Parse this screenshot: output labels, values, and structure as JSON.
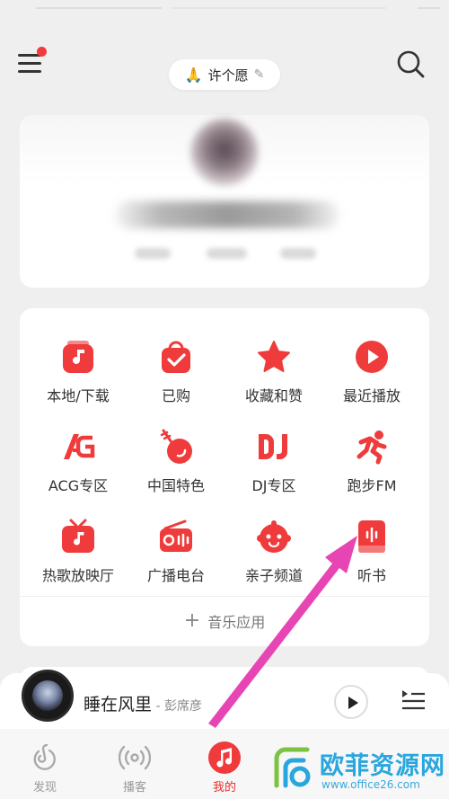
{
  "header": {
    "wish_label": "许个愿"
  },
  "grid": {
    "items": [
      {
        "label": "本地/下载",
        "icon": "music-note-file-icon"
      },
      {
        "label": "已购",
        "icon": "shopping-bag-check-icon"
      },
      {
        "label": "收藏和赞",
        "icon": "star-icon"
      },
      {
        "label": "最近播放",
        "icon": "play-circle-icon"
      },
      {
        "label": "ACG专区",
        "icon": "acg-logo-icon"
      },
      {
        "label": "中国特色",
        "icon": "pipa-instrument-icon"
      },
      {
        "label": "DJ专区",
        "icon": "dj-icon"
      },
      {
        "label": "跑步FM",
        "icon": "running-person-icon"
      },
      {
        "label": "热歌放映厅",
        "icon": "tv-music-icon"
      },
      {
        "label": "广播电台",
        "icon": "radio-icon"
      },
      {
        "label": "亲子频道",
        "icon": "kid-face-icon"
      },
      {
        "label": "听书",
        "icon": "audiobook-icon"
      }
    ],
    "add_app_label": "音乐应用"
  },
  "player": {
    "song_title": "睡在风里",
    "artist": " - 彭席彦"
  },
  "tabs": [
    {
      "label": "发现",
      "icon": "netease-logo-icon",
      "active": false
    },
    {
      "label": "播客",
      "icon": "podcast-icon",
      "active": false
    },
    {
      "label": "我的",
      "icon": "music-note-icon",
      "active": true
    }
  ],
  "watermark": {
    "title": "欧菲资源网",
    "url": "www.office26.com"
  },
  "colors": {
    "accent": "#ef3b3b",
    "watermark": "#2aa6de",
    "annotation_arrow": "#e845b4"
  }
}
